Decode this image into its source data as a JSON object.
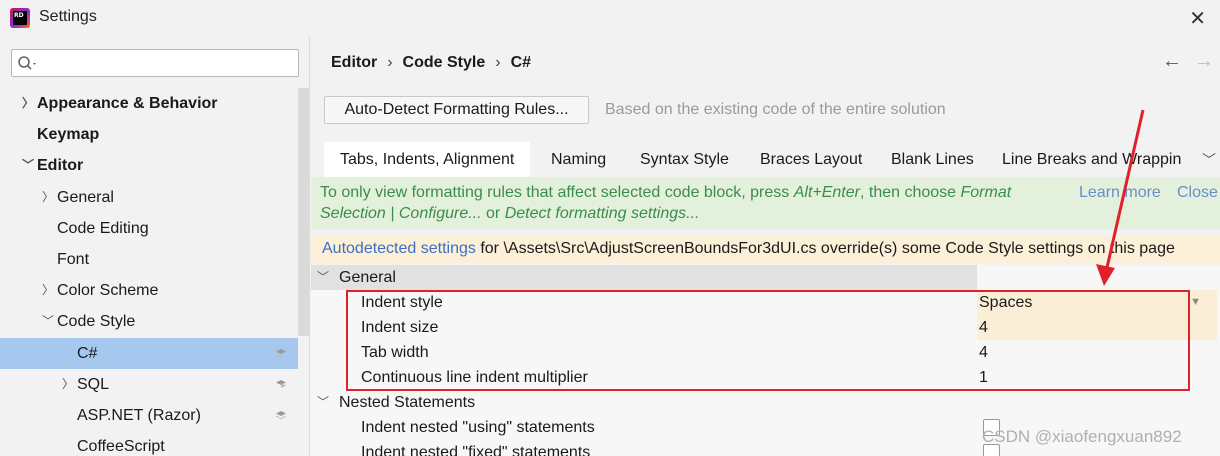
{
  "window": {
    "title": "Settings"
  },
  "sidebar": {
    "search_value": "",
    "items": [
      {
        "label": "Appearance & Behavior",
        "level": 0,
        "bold": true,
        "chevron": "chevron-right"
      },
      {
        "label": "Keymap",
        "level": 0,
        "bold": true,
        "chevron": ""
      },
      {
        "label": "Editor",
        "level": 0,
        "bold": true,
        "chevron": "chevron-down"
      },
      {
        "label": "General",
        "level": 1,
        "bold": false,
        "chevron": "chevron-right"
      },
      {
        "label": "Code Editing",
        "level": 1,
        "bold": false,
        "chevron": ""
      },
      {
        "label": "Font",
        "level": 1,
        "bold": false,
        "chevron": ""
      },
      {
        "label": "Color Scheme",
        "level": 1,
        "bold": false,
        "chevron": "chevron-right"
      },
      {
        "label": "Code Style",
        "level": 1,
        "bold": false,
        "chevron": "chevron-down"
      },
      {
        "label": "C#",
        "level": 2,
        "bold": false,
        "chevron": "",
        "selected": true,
        "icon": "layers-icon"
      },
      {
        "label": "SQL",
        "level": 2,
        "bold": false,
        "chevron": "chevron-right",
        "icon": "layers-half-icon"
      },
      {
        "label": "ASP.NET (Razor)",
        "level": 2,
        "bold": false,
        "chevron": "",
        "icon": "layers-icon"
      },
      {
        "label": "CoffeeScript",
        "level": 2,
        "bold": false,
        "chevron": ""
      }
    ]
  },
  "breadcrumb": [
    "Editor",
    "Code Style",
    "C#"
  ],
  "toolbar": {
    "autodetect_label": "Auto-Detect Formatting Rules...",
    "autodetect_hint": "Based on the existing code of the entire solution"
  },
  "tabs": [
    {
      "label": "Tabs, Indents, Alignment",
      "active": true
    },
    {
      "label": "Naming"
    },
    {
      "label": "Syntax Style"
    },
    {
      "label": "Braces Layout"
    },
    {
      "label": "Blank Lines"
    },
    {
      "label": "Line Breaks and Wrappin"
    }
  ],
  "info_banner": {
    "text_1": "To only view formatting rules that affect selected code block, press ",
    "shortcut": "Alt+Enter",
    "text_2": ", then choose ",
    "action_1": "Format Selection | Configure...",
    "text_3": " or ",
    "action_2": "Detect formatting settings...",
    "learn_more": "Learn more",
    "close": "Close"
  },
  "warn_banner": {
    "link": "Autodetected settings",
    "text": " for \\Assets\\Src\\AdjustScreenBoundsFor3dUI.cs override(s) some Code Style settings on this page"
  },
  "settings": {
    "general_section": "General",
    "indent_style_label": "Indent style",
    "indent_style_value": "Spaces",
    "indent_size_label": "Indent size",
    "indent_size_value": "4",
    "tab_width_label": "Tab width",
    "tab_width_value": "4",
    "continuous_label": "Continuous line indent multiplier",
    "continuous_value": "1",
    "nested_section": "Nested Statements",
    "nested_using_label": "Indent nested \"using\" statements",
    "nested_fixed_label": "Indent nested \"fixed\" statements"
  },
  "watermark": "CSDN @xiaofengxuan892",
  "colors": {
    "selection": "#a7c8ee",
    "info_banner_bg": "#e3f1dc",
    "info_text": "#3c8c4a",
    "warn_banner_bg": "#fcf0d8",
    "link": "#3b6fc6",
    "annotation_red": "#e0202a"
  }
}
